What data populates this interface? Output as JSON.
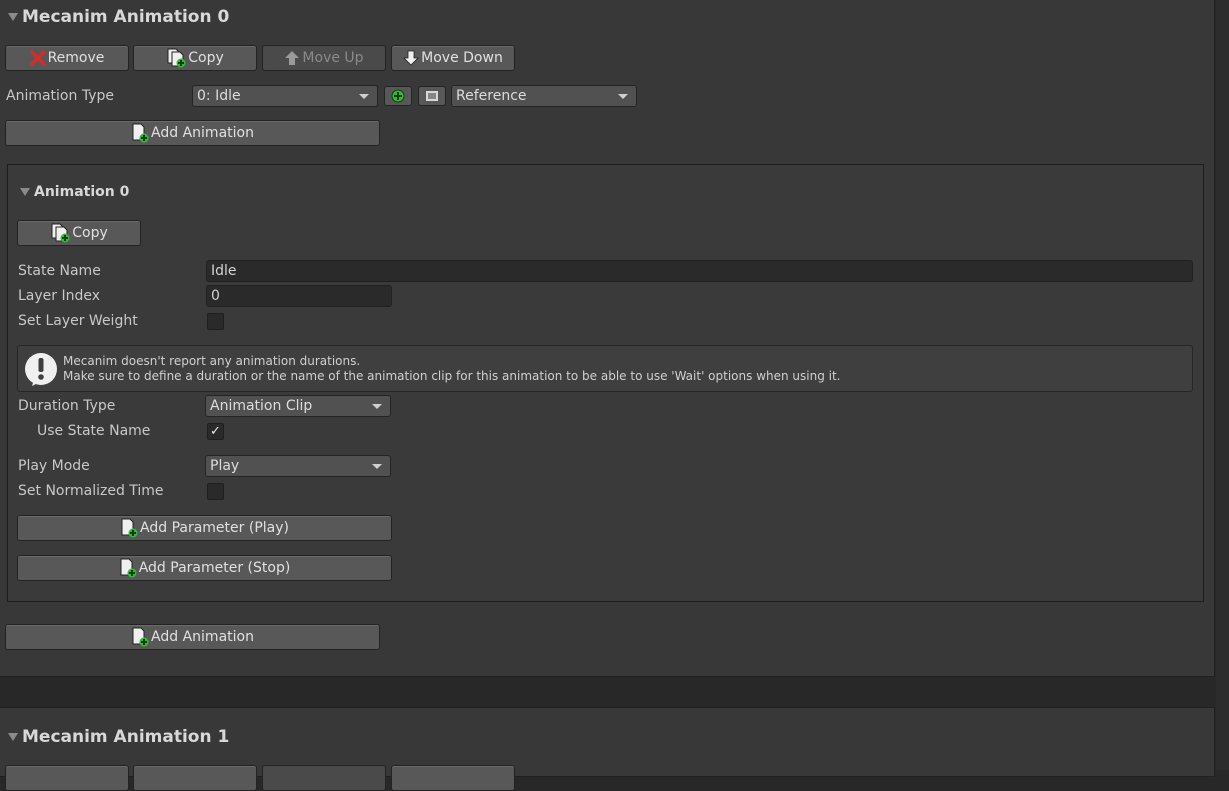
{
  "section0": {
    "title": "Mecanim Animation 0",
    "buttons": {
      "remove": "Remove",
      "copy": "Copy",
      "move_up": "Move Up",
      "move_down": "Move Down"
    },
    "animation_type_label": "Animation Type",
    "animation_type_value": "0: Idle",
    "reference_value": "Reference",
    "add_animation_label": "Add Animation",
    "add_animation_bottom_label": "Add Animation"
  },
  "animation0": {
    "title": "Animation 0",
    "copy_label": "Copy",
    "state_name_label": "State Name",
    "state_name_value": "Idle",
    "layer_index_label": "Layer Index",
    "layer_index_value": "0",
    "set_layer_weight_label": "Set Layer Weight",
    "help_line1": "Mecanim doesn't report any animation durations.",
    "help_line2": "Make sure to define a duration or the name of the animation clip for this animation to be able to use 'Wait' options when using it.",
    "duration_type_label": "Duration Type",
    "duration_type_value": "Animation Clip",
    "use_state_name_label": "Use State Name",
    "use_state_name_check": "✓",
    "play_mode_label": "Play Mode",
    "play_mode_value": "Play",
    "set_normalized_time_label": "Set Normalized Time",
    "add_param_play_label": "Add Parameter (Play)",
    "add_param_stop_label": "Add Parameter (Stop)"
  },
  "section1": {
    "title": "Mecanim Animation 1"
  },
  "colors": {
    "background": "#282828",
    "panel": "#383838",
    "button": "#585858",
    "remove_icon": "#d42b2b",
    "add_icon": "#35b935"
  }
}
